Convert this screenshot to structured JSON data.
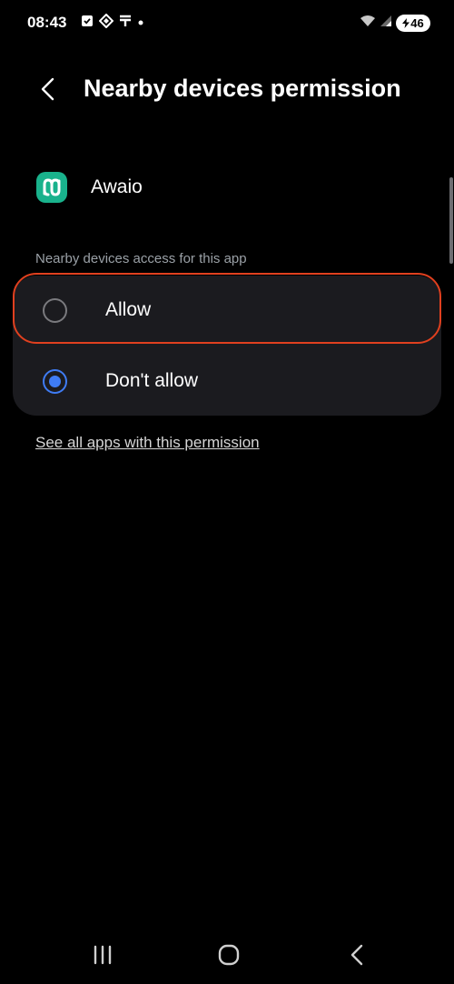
{
  "status_bar": {
    "time": "08:43",
    "battery_level": "46"
  },
  "header": {
    "title": "Nearby devices permission"
  },
  "app": {
    "name": "Awaio",
    "icon_color": "#19b28c"
  },
  "section": {
    "label": "Nearby devices access for this app"
  },
  "options": [
    {
      "label": "Allow",
      "selected": false
    },
    {
      "label": "Don't allow",
      "selected": true
    }
  ],
  "link": {
    "label": "See all apps with this permission"
  },
  "colors": {
    "background": "#000000",
    "card": "#1b1b1f",
    "accent": "#3f7cf4",
    "highlight": "#e0401f",
    "secondary_text": "#9aa0a6"
  }
}
